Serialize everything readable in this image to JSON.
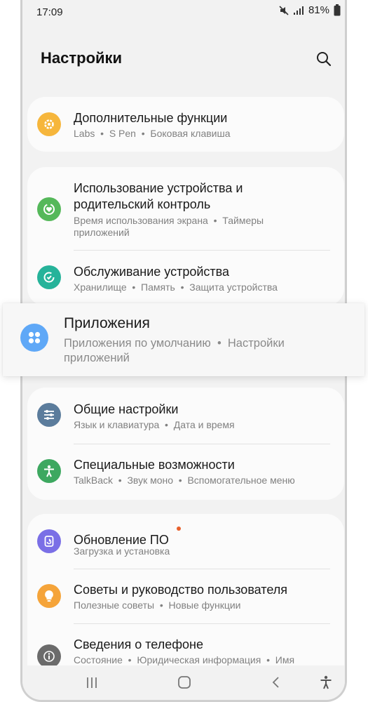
{
  "status": {
    "time": "17:09",
    "battery": "81%"
  },
  "header": {
    "title": "Настройки"
  },
  "items": {
    "advanced": {
      "title": "Дополнительные функции",
      "sub": "Labs  •  S Pen  •  Боковая клавиша"
    },
    "wellbeing": {
      "title_line1": "Использование устройства и",
      "title_line2": "родительский контроль",
      "sub_line1": "Время использования экрана  •  Таймеры",
      "sub_line2": "приложений"
    },
    "care": {
      "title": "Обслуживание устройства",
      "sub": "Хранилище  •  Память  •  Защита устройства"
    },
    "apps": {
      "title": "Приложения",
      "sub_line1": "Приложения по умолчанию  •  Настройки",
      "sub_line2": "приложений"
    },
    "general": {
      "title": "Общие настройки",
      "sub": "Язык и клавиатура  •  Дата и время"
    },
    "accessibility": {
      "title": "Специальные возможности",
      "sub": "TalkBack  •  Звук моно  •  Вспомогательное меню"
    },
    "update": {
      "title": "Обновление ПО",
      "sub": "Загрузка и установка"
    },
    "tips": {
      "title": "Советы и руководство пользователя",
      "sub": "Полезные советы  •  Новые функции"
    },
    "about": {
      "title": "Сведения о телефоне",
      "sub": "Состояние  •  Юридическая информация  •  Имя"
    }
  },
  "colors": {
    "advanced": "#f6b63c",
    "wellbeing": "#55b85a",
    "care": "#26b39a",
    "apps": "#5fa8f7",
    "general": "#5b7c9c",
    "accessibility": "#3da860",
    "update": "#7a6fe6",
    "tips": "#f5a43a",
    "about": "#6b6b6b",
    "update_dot": "#e8602c"
  },
  "icons": {
    "advanced": "gear-plus-icon",
    "wellbeing": "heart-cycle-icon",
    "care": "refresh-care-icon",
    "apps": "app-grid-icon",
    "general": "sliders-icon",
    "accessibility": "accessibility-person-icon",
    "update": "system-update-icon",
    "tips": "lightbulb-icon",
    "about": "info-icon",
    "nav_recent": "recent-apps-icon",
    "nav_home": "home-icon",
    "nav_back": "back-icon",
    "nav_access": "accessibility-button-icon"
  }
}
